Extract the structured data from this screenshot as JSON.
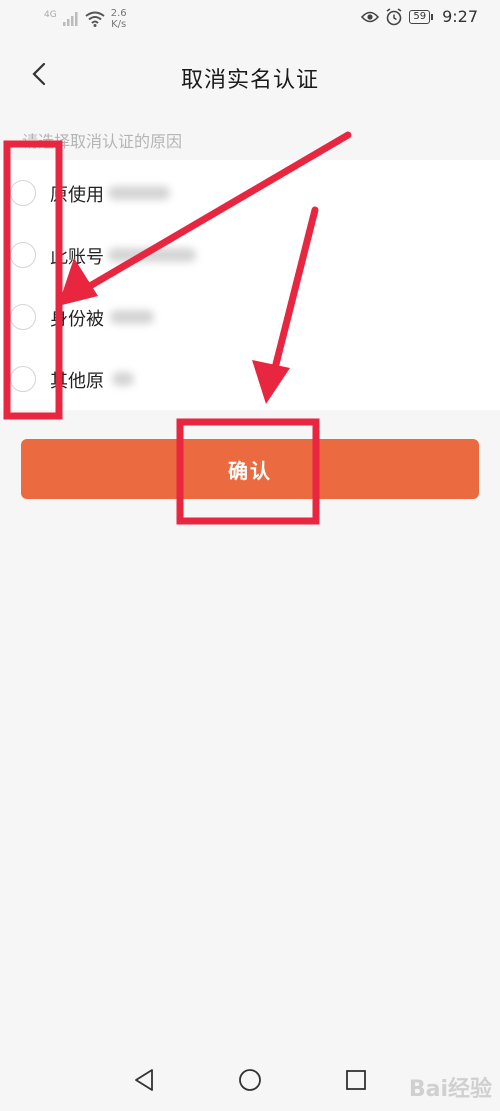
{
  "status_bar": {
    "network": "4G",
    "speed_value": "2.6",
    "speed_unit": "K/s",
    "battery": "59",
    "time": "9:27"
  },
  "header": {
    "title": "取消实名认证"
  },
  "section_label": "请选择取消认证的原因",
  "options": [
    {
      "label": "原使用"
    },
    {
      "label": "此账号"
    },
    {
      "label": "身份被"
    },
    {
      "label": "其他原"
    }
  ],
  "confirm_label": "确认",
  "watermark": "Bai经验",
  "colors": {
    "accent": "#ec6a3f",
    "annotation": "#e8263f",
    "background": "#f6f6f6"
  }
}
